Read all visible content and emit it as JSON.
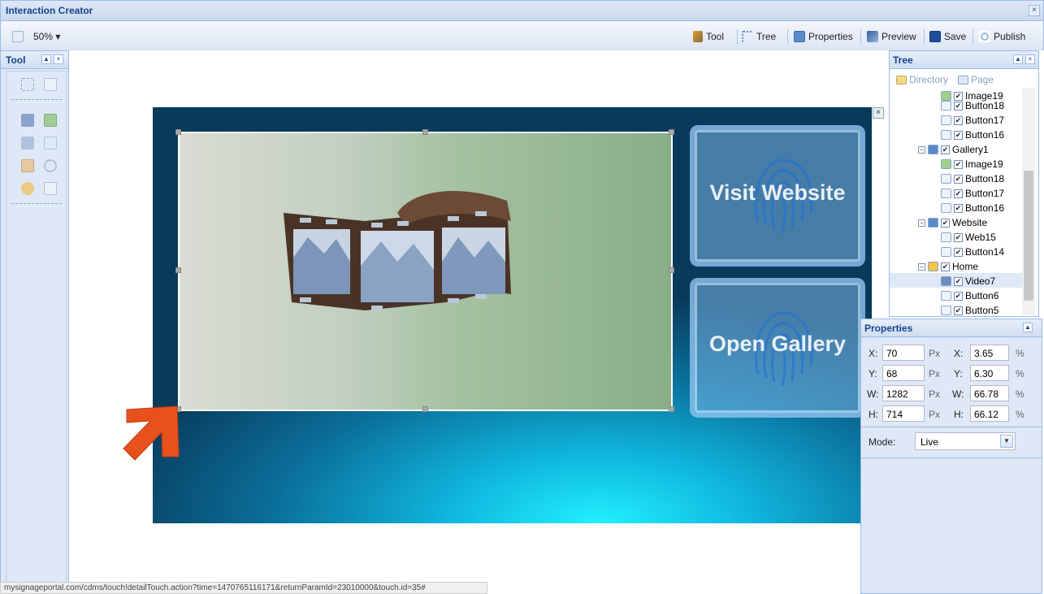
{
  "window": {
    "title": "Interaction Creator",
    "close": "×"
  },
  "toolbar": {
    "zoom": "50% ▾",
    "tool": "Tool",
    "tree": "Tree",
    "properties": "Properties",
    "preview": "Preview",
    "save": "Save",
    "publish": "Publish"
  },
  "tool_panel": {
    "title": "Tool",
    "collapse": "▲",
    "close": "×"
  },
  "stage": {
    "tiles": [
      {
        "label": "Visit Website"
      },
      {
        "label": "Open Gallery"
      }
    ],
    "close": "×"
  },
  "tree_panel": {
    "title": "Tree",
    "collapse": "▲",
    "close": "×",
    "tabs": {
      "directory": "Directory",
      "page": "Page"
    },
    "nodes": [
      {
        "label": "Image19",
        "kind": "image"
      },
      {
        "label": "Button18",
        "kind": "button"
      },
      {
        "label": "Button17",
        "kind": "button"
      },
      {
        "label": "Button16",
        "kind": "button"
      },
      {
        "label": "Gallery1",
        "kind": "page"
      },
      {
        "label": "Image19",
        "kind": "image"
      },
      {
        "label": "Button18",
        "kind": "button"
      },
      {
        "label": "Button17",
        "kind": "button"
      },
      {
        "label": "Button16",
        "kind": "button"
      },
      {
        "label": "Website",
        "kind": "page"
      },
      {
        "label": "Web15",
        "kind": "web"
      },
      {
        "label": "Button14",
        "kind": "button"
      },
      {
        "label": "Home",
        "kind": "home"
      },
      {
        "label": "Video7",
        "kind": "video",
        "selected": true
      },
      {
        "label": "Button6",
        "kind": "button"
      },
      {
        "label": "Button5",
        "kind": "button"
      }
    ]
  },
  "properties": {
    "title": "Properties",
    "collapse": "▲",
    "px": {
      "x": "70",
      "y": "68",
      "w": "1282",
      "h": "714"
    },
    "pct": {
      "x": "3.65",
      "y": "6.30",
      "w": "66.78",
      "h": "66.12"
    },
    "labels": {
      "x": "X:",
      "y": "Y:",
      "w": "W:",
      "h": "H:",
      "px": "Px",
      "pct": "%"
    },
    "mode_label": "Mode:",
    "mode_value": "Live"
  },
  "status_bar": "mysignageportal.com/cdms/touch!detailTouch.action?time=1470765116171&returnParamId=23010000&touch.id=35#",
  "colors": {
    "panel_bg": "#dfe8f6",
    "border": "#99bbe8",
    "header_text": "#15428b",
    "arrow": "#e8501c"
  }
}
